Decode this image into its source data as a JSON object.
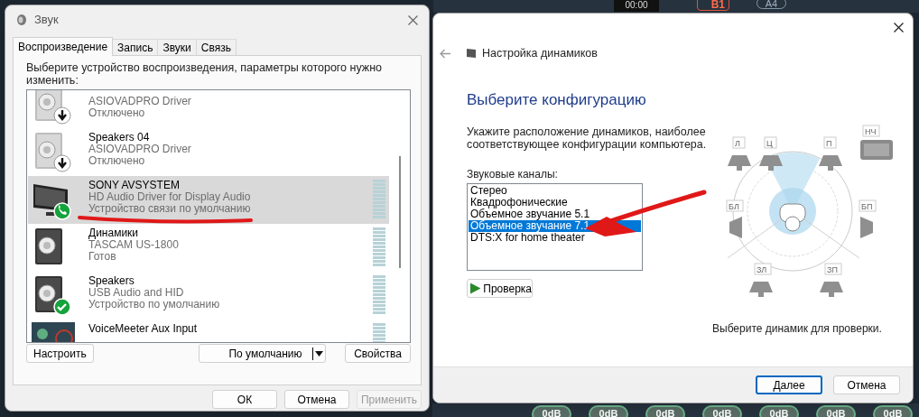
{
  "background": {
    "timer": "00:00",
    "bus_label": "B1",
    "output_label": "A4",
    "gain_readings": [
      "0dB",
      "0dB",
      "0dB",
      "0dB",
      "0dB",
      "0dB",
      "0dB"
    ]
  },
  "sound_dialog": {
    "title": "Звук",
    "tabs": [
      {
        "label": "Воспроизведение",
        "selected": true
      },
      {
        "label": "Запись",
        "selected": false
      },
      {
        "label": "Звуки",
        "selected": false
      },
      {
        "label": "Связь",
        "selected": false
      }
    ],
    "instruction": "Выберите устройство воспроизведения, параметры которого нужно изменить:",
    "devices": [
      {
        "kind": "speaker",
        "disabled": true,
        "default_device": false,
        "default_comms": false,
        "driver": "ASIOVADPRO Driver",
        "status": "Отключено",
        "meter": false,
        "selected": false
      },
      {
        "kind": "speaker",
        "disabled": true,
        "default_device": false,
        "default_comms": false,
        "name": "Speakers 04",
        "driver": "ASIOVADPRO Driver",
        "status": "Отключено",
        "meter": false,
        "selected": false
      },
      {
        "kind": "monitor",
        "disabled": false,
        "default_device": false,
        "default_comms": true,
        "name": "SONY AVSYSTEM",
        "driver": "HD Audio Driver for Display Audio",
        "status": "Устройство связи по умолчанию",
        "meter": true,
        "selected": true
      },
      {
        "kind": "speaker",
        "disabled": false,
        "default_device": false,
        "default_comms": false,
        "name": "Динамики",
        "driver": "TASCAM US-1800",
        "status": "Готов",
        "meter": true,
        "selected": false
      },
      {
        "kind": "speaker",
        "disabled": false,
        "default_device": true,
        "default_comms": false,
        "name": "Speakers",
        "driver": "USB Audio and HID",
        "status": "Устройство по умолчанию",
        "meter": true,
        "selected": false
      },
      {
        "kind": "app",
        "disabled": false,
        "default_device": false,
        "default_comms": false,
        "name": "VoiceMeeter Aux Input",
        "meter": true,
        "selected": false
      }
    ],
    "configure_button": "Настроить",
    "default_button": "По умолчанию",
    "properties_button": "Свойства",
    "footer_buttons": [
      {
        "label": "ОК",
        "disabled": false
      },
      {
        "label": "Отмена",
        "disabled": false
      },
      {
        "label": "Применить",
        "disabled": true
      }
    ]
  },
  "speaker_setup": {
    "title": "Настройка динамиков",
    "heading": "Выберите конфигурацию",
    "description": "Укажите расположение динамиков, наиболее соответствующее конфигурации компьютера.",
    "channels_label": "Звуковые каналы:",
    "channels": [
      {
        "label": "Стерео",
        "selected": false
      },
      {
        "label": "Квадрофонические",
        "selected": false
      },
      {
        "label": "Объемное звучание 5.1",
        "selected": false
      },
      {
        "label": "Объемное звучание 7.1",
        "selected": true
      },
      {
        "label": "DTS:X for home theater",
        "selected": false
      }
    ],
    "test_button": "Проверка",
    "speaker_labels": [
      "Л",
      "Ц",
      "П",
      "НЧ",
      "БЛ",
      "БП",
      "ЗЛ",
      "ЗП"
    ],
    "hint": "Выберите динамик для проверки.",
    "next_button": "Далее",
    "cancel_button": "Отмена"
  }
}
